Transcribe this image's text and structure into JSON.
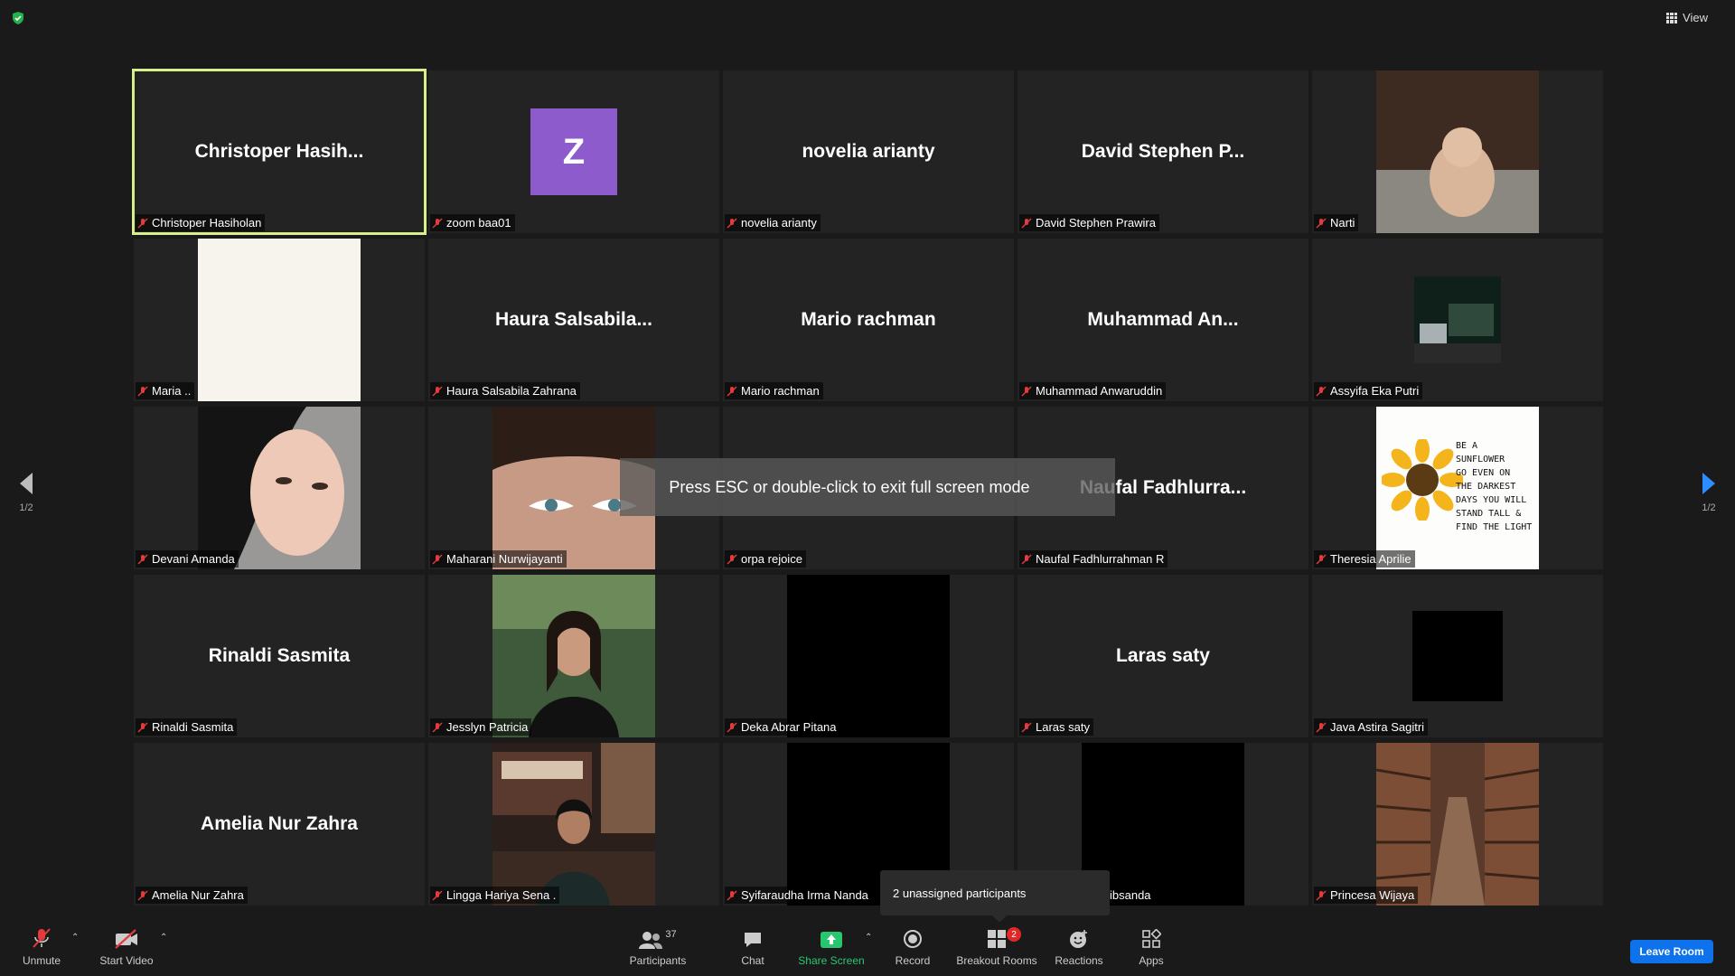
{
  "topbar": {
    "view_label": "View"
  },
  "pagination": {
    "left": "1/2",
    "right": "1/2"
  },
  "tiles": [
    {
      "display": "Christoper  Hasih...",
      "label": "Christoper Hasiholan"
    },
    {
      "display": "",
      "avatar": "Z",
      "label": "zoom baa01"
    },
    {
      "display": "novelia arianty",
      "label": "novelia arianty"
    },
    {
      "display": "David Stephen P...",
      "label": "David Stephen Prawira"
    },
    {
      "display": "",
      "image": "cat-photo",
      "label": "Narti"
    },
    {
      "display": "",
      "image": "blank-cream",
      "label": "Maria .."
    },
    {
      "display": "Haura  Salsabila...",
      "label": "Haura Salsabila Zahrana"
    },
    {
      "display": "Mario rachman",
      "label": "Mario rachman"
    },
    {
      "display": "Muhammad  An...",
      "label": "Muhammad Anwaruddin"
    },
    {
      "display": "",
      "image": "street-photo",
      "label": "Assyifa Eka Putri"
    },
    {
      "display": "",
      "image": "portrait-hijab",
      "label": "Devani Amanda"
    },
    {
      "display": "",
      "image": "portrait-eyes",
      "label": "Maharani Nurwijayanti"
    },
    {
      "display": "",
      "label": "orpa rejoice"
    },
    {
      "display": "Naufal  Fadhlurra...",
      "label": "Naufal Fadhlurrahman R"
    },
    {
      "display": "",
      "image": "sunflower-quote",
      "label": "Theresia Aprilie"
    },
    {
      "display": "Rinaldi Sasmita",
      "label": "Rinaldi Sasmita"
    },
    {
      "display": "",
      "image": "portrait-woman",
      "label": "Jesslyn Patricia"
    },
    {
      "display": "",
      "image": "black-video",
      "label": "Deka Abrar Pitana"
    },
    {
      "display": "Laras saty",
      "label": "Laras saty"
    },
    {
      "display": "",
      "image": "black-square",
      "label": "Java Astira Sagitri"
    },
    {
      "display": "Amelia Nur Zahra",
      "label": "Amelia Nur Zahra"
    },
    {
      "display": "",
      "image": "cafe-man",
      "label": "Lingga Hariya Sena ."
    },
    {
      "display": "",
      "image": "black-video",
      "label": "Syifaraudha Irma Nanda"
    },
    {
      "display": "",
      "image": "black-video",
      "label": "ibsanda"
    },
    {
      "display": "",
      "image": "bookshelf-photo",
      "label": "Princesa Wijaya"
    }
  ],
  "sunflower_quote": [
    "BE A",
    "SUNFLOWER",
    "GO EVEN ON",
    "THE DARKEST",
    "DAYS YOU WILL",
    "STAND TALL &",
    "FIND THE LIGHT"
  ],
  "overlay": {
    "fullscreen_hint": "Press ESC or double-click to exit full screen mode",
    "unassigned": "2 unassigned participants"
  },
  "toolbar": {
    "unmute": "Unmute",
    "start_video": "Start Video",
    "participants": "Participants",
    "participants_count": "37",
    "chat": "Chat",
    "share_screen": "Share Screen",
    "record": "Record",
    "breakout_rooms": "Breakout Rooms",
    "breakout_badge": "2",
    "reactions": "Reactions",
    "apps": "Apps",
    "leave_room": "Leave Room"
  },
  "colors": {
    "active_border": "#d9ef8b",
    "share_green": "#28c76f",
    "leave_blue": "#0e72ed",
    "badge_red": "#e02828",
    "avatar_purple": "#8e5bcc"
  }
}
